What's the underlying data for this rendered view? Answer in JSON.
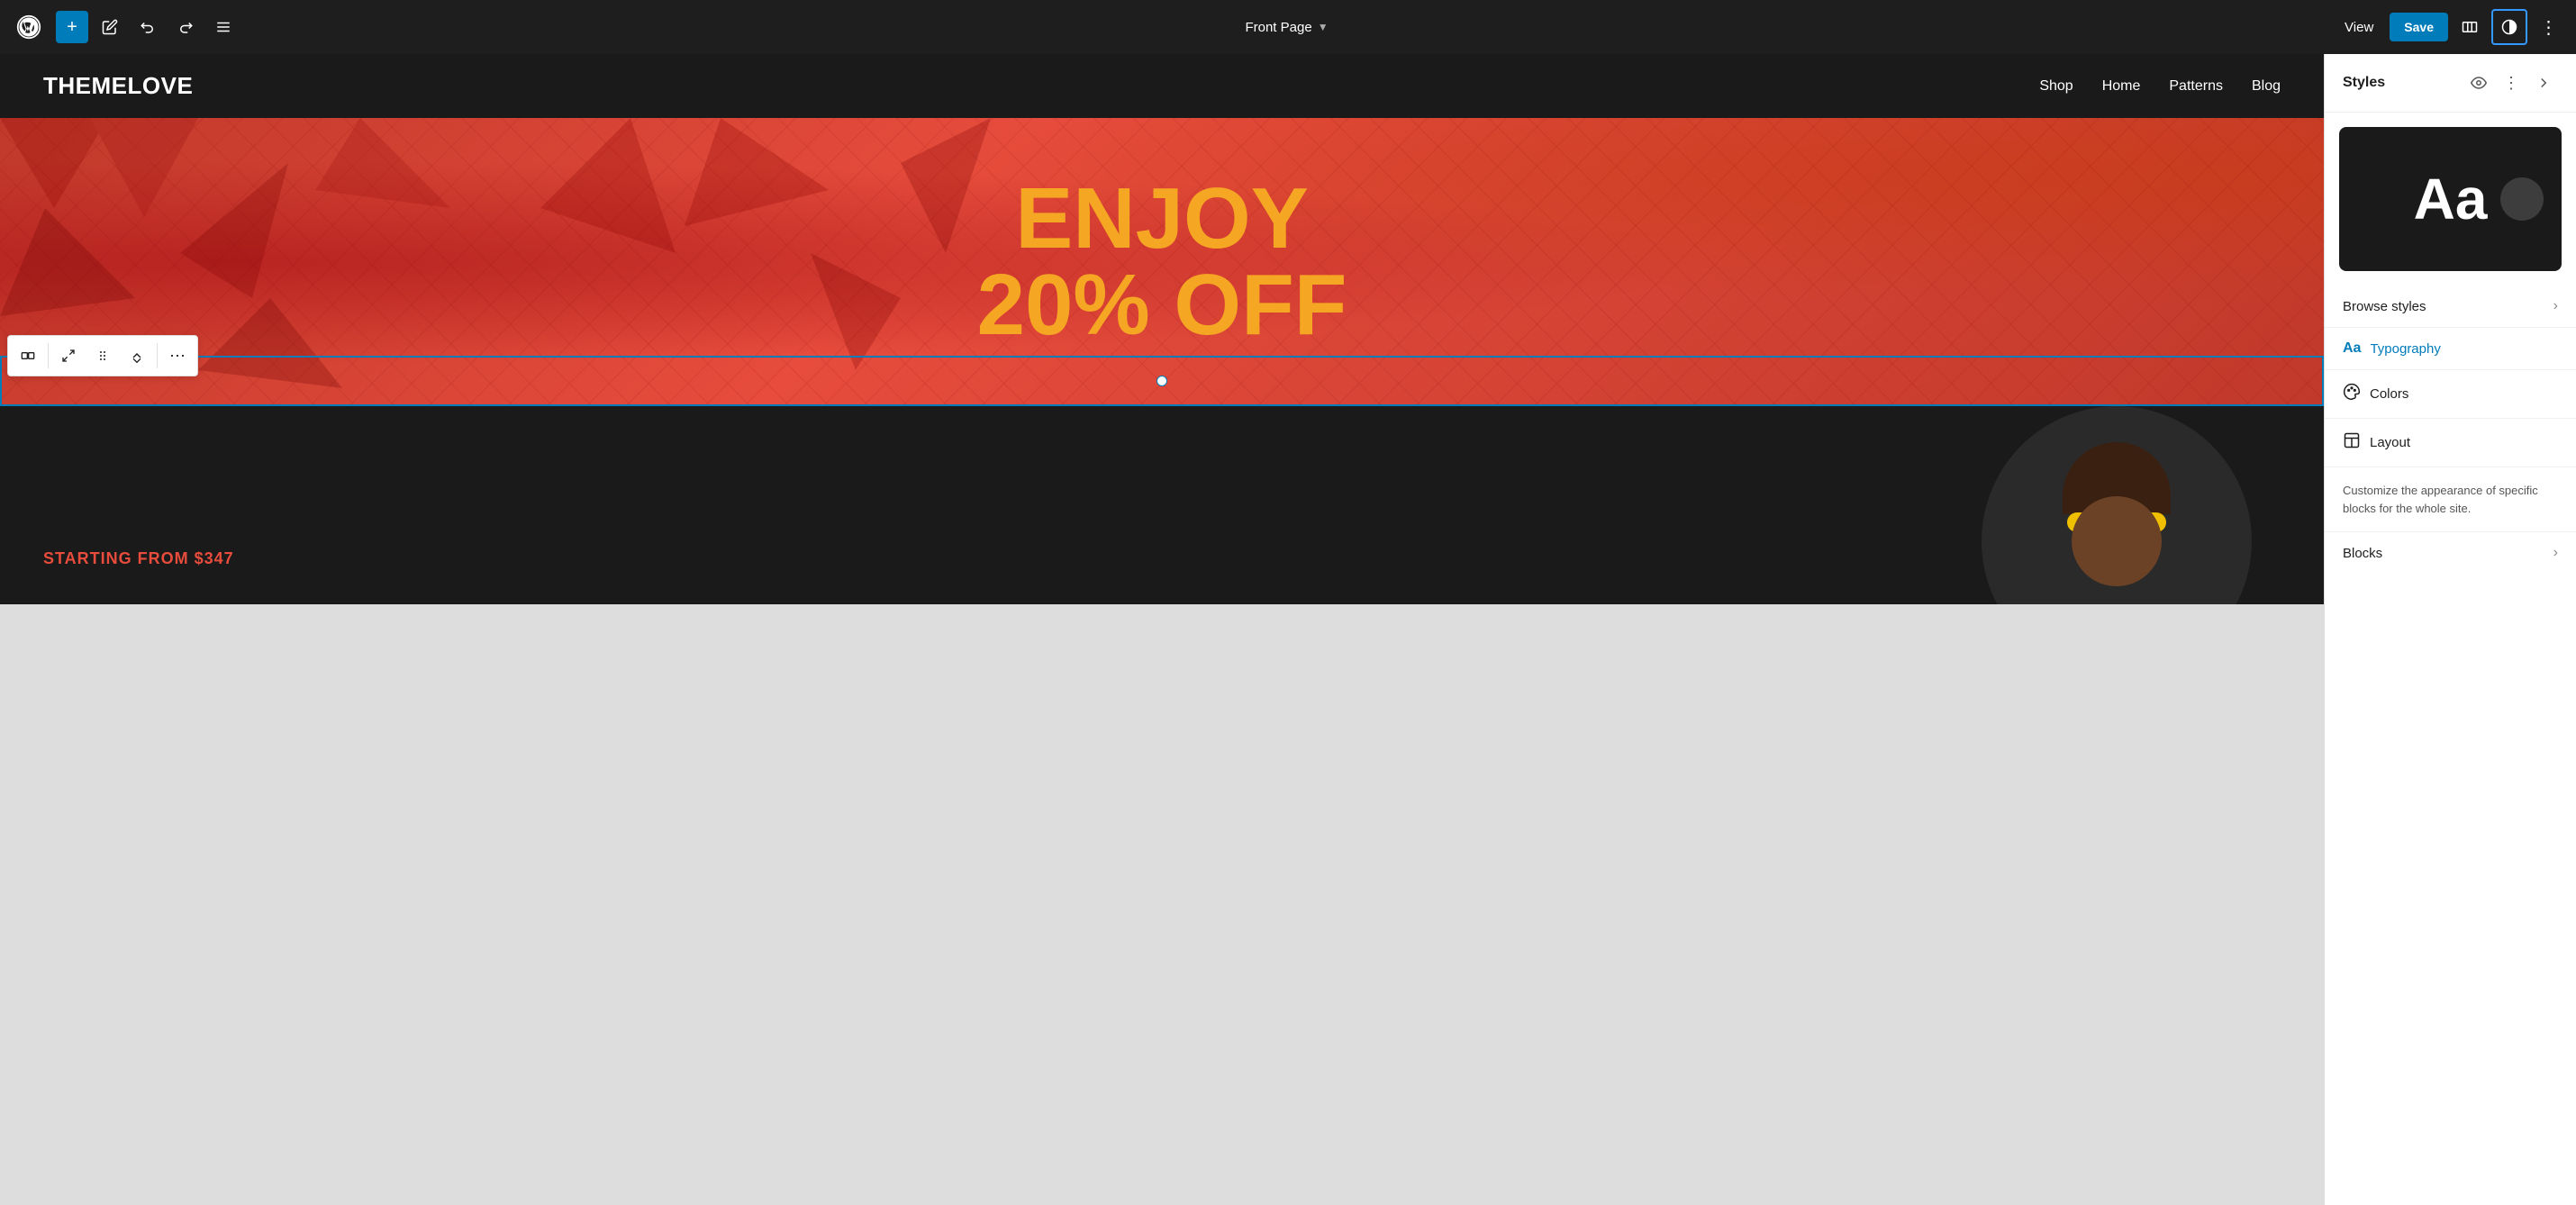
{
  "toolbar": {
    "page_title": "Front Page",
    "view_label": "View",
    "save_label": "Save"
  },
  "canvas": {
    "site_logo": "THEMELOVE",
    "nav_items": [
      "Shop",
      "Home",
      "Patterns",
      "Blog"
    ],
    "hero_title_line1": "ENJOY",
    "hero_title_line2": "20% OFF",
    "starting_from": "STARTING FROM $347"
  },
  "styles_panel": {
    "title": "Styles",
    "preview_text": "Aa",
    "browse_styles_label": "Browse styles",
    "typography_label": "Typography",
    "colors_label": "Colors",
    "layout_label": "Layout",
    "description": "Customize the appearance of specific blocks for the whole site.",
    "blocks_label": "Blocks"
  },
  "icons": {
    "plus": "+",
    "pen": "✏",
    "undo": "↩",
    "redo": "↪",
    "list": "≡",
    "chevron_down": "⌄",
    "view": "👁",
    "more_vertical": "⋮",
    "more_horiz": "⋯",
    "chevron_right": "›",
    "close": "✕",
    "expand": "⤢",
    "move": "⠿",
    "up_down": "↕",
    "half_circle": "◑",
    "eye": "👁",
    "colors_icon": "◎",
    "layout_icon": "▣",
    "typo_icon": "Aa"
  }
}
